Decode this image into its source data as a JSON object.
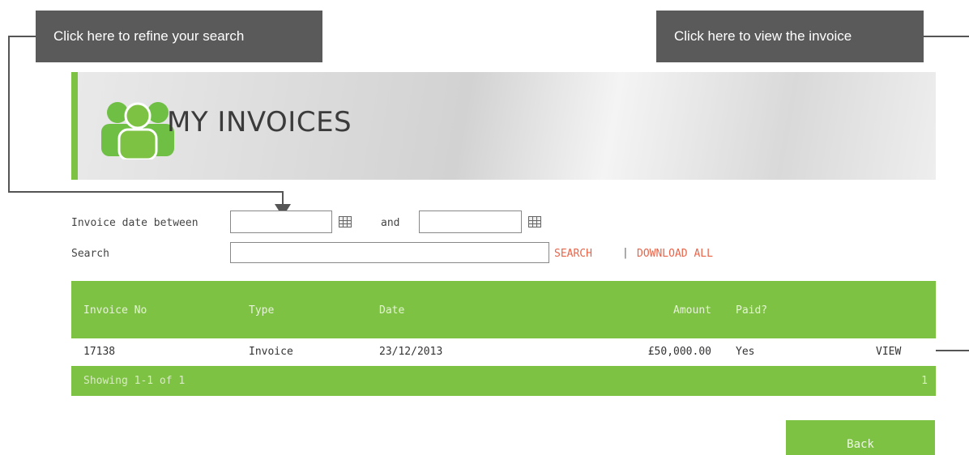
{
  "callouts": {
    "left": "Click here to refine your search",
    "right": "Click here to view the invoice"
  },
  "banner": {
    "title": "MY INVOICES",
    "icon": "people-group-icon"
  },
  "filters": {
    "date_label": "Invoice date between",
    "date_from_value": "",
    "and_label": "and",
    "date_to_value": "",
    "search_label": "Search",
    "search_value": "",
    "search_link": "SEARCH",
    "separator": "|",
    "download_link": "DOWNLOAD ALL"
  },
  "table": {
    "columns": [
      "Invoice No",
      "Type",
      "Date",
      "Amount",
      "Paid?"
    ],
    "rows": [
      {
        "invoice_no": "17138",
        "type": "Invoice",
        "date": "23/12/2013",
        "amount": "£50,000.00",
        "paid": "Yes",
        "action": "VIEW"
      }
    ],
    "footer": {
      "showing": "Showing 1-1 of 1",
      "page": "1"
    }
  },
  "actions": {
    "back": "Back"
  },
  "colors": {
    "accent_green": "#7dc243",
    "link_orange": "#e8654a",
    "callout_gray": "#5a5a5a"
  }
}
